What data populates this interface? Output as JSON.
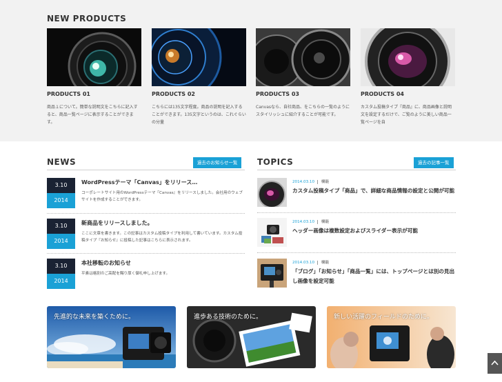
{
  "new_products": {
    "title": "NEW PRODUCTS",
    "items": [
      {
        "name": "PRODUCTS 01",
        "desc": "商品１について。簡単な説明文をこちらに記入すると、商品一覧ページに表示することができます。"
      },
      {
        "name": "PRODUCTS 02",
        "desc": "こちらには135文字程度。商品の説明を記入することができます。135文字というのは、これぐらいの分量"
      },
      {
        "name": "PRODUCTS 03",
        "desc": "Canvasなら、自社商品、をこちらの一覧のようにスタイリッシュに紹介することが可能です。"
      },
      {
        "name": "PRODUCTS 04",
        "desc": "カスタム投稿タイプ『商品』に、商品画像と説明文を設定するだけで、ご覧のように美しい商品一覧ページを自"
      }
    ]
  },
  "news": {
    "title": "NEWS",
    "button": "過去のお知らせ一覧",
    "items": [
      {
        "day": "3.10",
        "year": "2014",
        "title": "WordPressテーマ「Canvas」をリリース…",
        "desc": "コーポレートサイト用のWordPressテーマ『Canvas』をリリースしました。会社用のウェブサイトを作成することができます。"
      },
      {
        "day": "3.10",
        "year": "2014",
        "title": "新商品をリリースしました。",
        "desc": "ここに文章を書きます。この記事はカスタム投稿タイプを利用して書いています。カスタム投稿タイプ『お知らせ』に投稿した記事はこちらに表示されます。"
      },
      {
        "day": "3.10",
        "year": "2014",
        "title": "本社移転のお知らせ",
        "desc": "平素は格別のご高配を賜り厚く御礼申し上げます。"
      }
    ]
  },
  "topics": {
    "title": "TOPICS",
    "button": "過去の記事一覧",
    "items": [
      {
        "date": "2014.03.10",
        "category": "機能",
        "title": "カスタム投稿タイプ「商品」で、詳細な商品情報の設定と公開が可能"
      },
      {
        "date": "2014.03.10",
        "category": "機能",
        "title": "ヘッダー画像は複数設定およびスライダー表示が可能"
      },
      {
        "date": "2014.03.10",
        "category": "機能",
        "title": "「ブログ」「お知らせ」「商品一覧」には、トップページとは別の見出し画像を設定可能"
      }
    ]
  },
  "banners": [
    {
      "text": "先進的な未来を築くために。"
    },
    {
      "text": "進歩ある技術のために。"
    },
    {
      "text": "新しい活躍のフィールドのために。"
    }
  ],
  "icons": [
    "lens-image",
    "camera-image",
    "arrow-up-icon"
  ],
  "colors": {
    "accent": "#1aa1d6",
    "dark": "#1a2233",
    "top_bg": "#f2f2f2"
  }
}
